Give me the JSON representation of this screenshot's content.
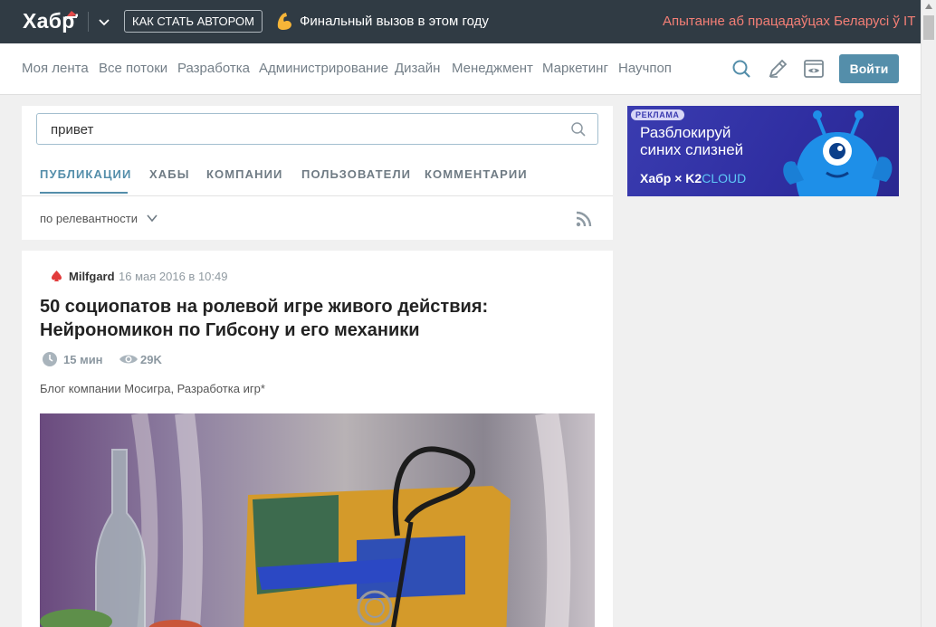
{
  "header": {
    "logo": "Хабр",
    "author_button": "КАК СТАТЬ АВТОРОМ",
    "promo": "Финальный вызов в этом году",
    "survey": "Апытанне аб працадаўцах Беларусі ў IT"
  },
  "nav": {
    "items": [
      "Моя лента",
      "Все потоки",
      "Разработка",
      "Администрирование",
      "Дизайн",
      "Менеджмент",
      "Маркетинг",
      "Научпоп"
    ],
    "login": "Войти"
  },
  "search": {
    "value": "привет",
    "tabs": [
      "ПУБЛИКАЦИИ",
      "ХАБЫ",
      "КОМПАНИИ",
      "ПОЛЬЗОВАТЕЛИ",
      "КОММЕНТАРИИ"
    ],
    "active_tab": 0,
    "sort": "по релевантности"
  },
  "article": {
    "author": "Milfgard",
    "date": "16 мая 2016 в 10:49",
    "title": "50 социопатов на ролевой игре живого действия: Нейрономикон по Гибсону и его механики",
    "read_time": "15 мин",
    "views": "29K",
    "hubs": "Блог компании Мосигра, Разработка игр*"
  },
  "ad": {
    "badge": "РЕКЛАМА",
    "text": "Разблокируй синих слизней",
    "brand_habr": "Хабр",
    "brand_x": "×",
    "brand_k2": "K2",
    "brand_cloud": "CLOUD"
  },
  "colors": {
    "topbar": "#303b44",
    "accent": "#548eaa",
    "survey": "#f47f76",
    "author_icon": "#e23b3b"
  },
  "icons": {
    "logo_hat": "santa-hat-icon",
    "menu": "chevron-down-icon",
    "promo": "flexed-arm-icon",
    "search": "search-icon",
    "write": "pen-icon",
    "settings": "eye-icon",
    "rss": "rss-icon",
    "author": "spade-icon",
    "time": "clock-icon",
    "views": "eye-icon"
  }
}
